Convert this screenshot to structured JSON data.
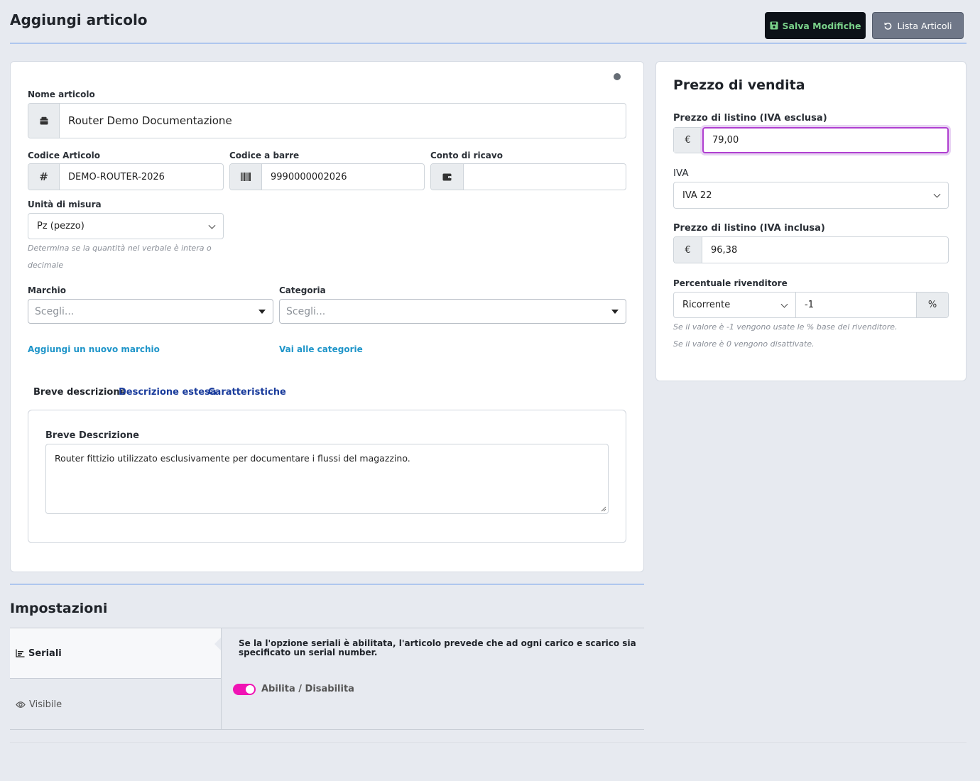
{
  "header": {
    "title": "Aggiungi articolo",
    "save_label": "Salva Modifiche",
    "list_label": "Lista Articoli"
  },
  "product": {
    "name_label": "Nome articolo",
    "name_value": "Router Demo Documentazione",
    "code_label": "Codice Articolo",
    "code_value": "DEMO-ROUTER-2026",
    "barcode_label": "Codice a barre",
    "barcode_value": "9990000002026",
    "revenue_label": "Conto di ricavo",
    "revenue_value": "",
    "unit_label": "Unità di misura",
    "unit_value": "Pz (pezzo)",
    "unit_hint_1": "Determina se la quantità nel verbale è intera o",
    "unit_hint_2": "decimale",
    "brand_label": "Marchio",
    "brand_placeholder": "Scegli...",
    "category_label": "Categoria",
    "category_placeholder": "Scegli...",
    "add_brand_link": "Aggiungi un nuovo marchio",
    "categories_link": "Vai alle categorie"
  },
  "tabs": [
    "Breve descrizione",
    "Descrizione estesa",
    "Caratteristiche"
  ],
  "description": {
    "label": "Breve Descrizione",
    "value": "Router fittizio utilizzato esclusivamente per documentare i flussi del magazzino."
  },
  "price": {
    "title": "Prezzo di vendita",
    "net_label": "Prezzo di listino (IVA esclusa)",
    "currency": "€",
    "net_value": "79,00",
    "vat_label": "IVA",
    "vat_value": "IVA 22",
    "gross_label": "Prezzo di listino (IVA inclusa)",
    "gross_value": "96,38",
    "reseller_label": "Percentuale rivenditore",
    "reseller_mode": "Ricorrente",
    "reseller_value": "-1",
    "percent_symbol": "%",
    "reseller_hint_1": "Se il valore è -1 vengono usate le % base del rivenditore.",
    "reseller_hint_2": "Se il valore è 0 vengono disattivate."
  },
  "settings": {
    "title": "Impostazioni",
    "items": [
      "Seriali",
      "Visibile"
    ],
    "serial_description": "Se la l'opzione seriali è abilitata, l'articolo prevede che ad ogni carico e scarico sia specificato un serial number.",
    "toggle_label": "Abilita / Disabilita"
  },
  "colors": {
    "accent": "#f014b4",
    "link": "#1f95c9",
    "tab_link": "#1a3c9c"
  }
}
